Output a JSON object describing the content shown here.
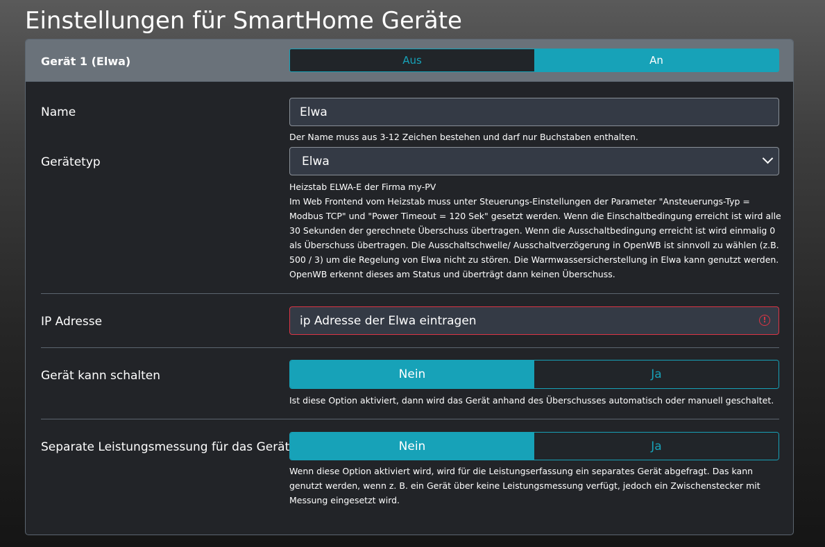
{
  "page": {
    "title": "Einstellungen für SmartHome Geräte"
  },
  "device": {
    "header_title": "Gerät 1 (Elwa)",
    "power_toggle": {
      "off_label": "Aus",
      "on_label": "An",
      "selected": "An"
    }
  },
  "fields": {
    "name": {
      "label": "Name",
      "value": "Elwa",
      "help": "Der Name muss aus 3-12 Zeichen bestehen und darf nur Buchstaben enthalten."
    },
    "device_type": {
      "label": "Gerätetyp",
      "selected": "Elwa",
      "help_title": "Heizstab ELWA-E der Firma my-PV",
      "help_body": "Im Web Frontend vom Heizstab muss unter Steuerungs-Einstellungen der Parameter \"Ansteuerungs-Typ = Modbus TCP\" und \"Power Timeout = 120 Sek\" gesetzt werden. Wenn die Einschaltbedingung erreicht ist wird alle 30 Sekunden der gerechnete Überschuss übertragen. Wenn die Ausschaltbedingung erreicht ist wird einmalig 0 als Überschuss übertragen. Die Ausschaltschwelle/ Ausschaltverzögerung in OpenWB ist sinnvoll zu wählen (z.B. 500 / 3) um die Regelung von Elwa nicht zu stören. Die Warmwassersicherstellung in Elwa kann genutzt werden. OpenWB erkennt dieses am Status und überträgt dann keinen Überschuss."
    },
    "ip_address": {
      "label": "IP Adresse",
      "placeholder": "ip Adresse der Elwa eintragen",
      "value": "",
      "status": "invalid"
    },
    "can_switch": {
      "label": "Gerät kann schalten",
      "no_label": "Nein",
      "yes_label": "Ja",
      "selected": "Nein",
      "help": "Ist diese Option aktiviert, dann wird das Gerät anhand des Überschusses automatisch oder manuell geschaltet."
    },
    "separate_metering": {
      "label": "Separate Leistungsmessung für das Gerät",
      "no_label": "Nein",
      "yes_label": "Ja",
      "selected": "Nein",
      "help": "Wenn diese Option aktiviert wird, wird für die Leistungserfassung ein separates Gerät abgefragt. Das kann genutzt werden, wenn z. B. ein Gerät über keine Leistungsmessung verfügt, jedoch ein Zwischenstecker mit Messung eingesetzt wird."
    }
  },
  "colors": {
    "accent": "#17a2b8",
    "error": "#dc3545",
    "card_bg": "#222428",
    "header_bg": "#6a727a",
    "field_bg": "#343a45"
  }
}
